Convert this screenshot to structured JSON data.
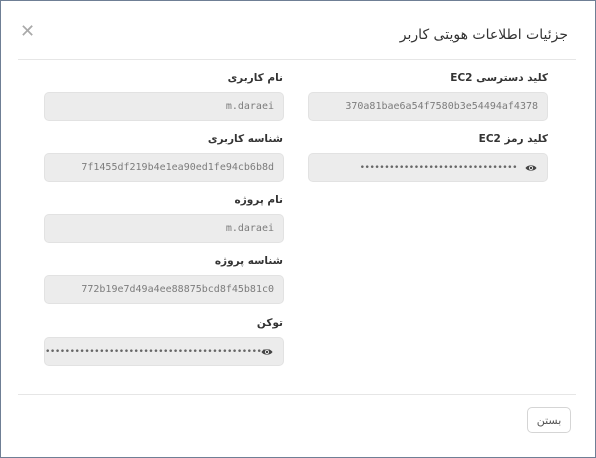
{
  "dialog": {
    "title": "جزئیات اطلاعات هویتی کاربر",
    "close_icon": "close-icon"
  },
  "right_column": {
    "ec2_access_key": {
      "label": "کلید دسترسی EC2",
      "value": "370a81bae6a54f7580b3e54494af4378"
    },
    "ec2_secret_key": {
      "label": "کلید رمز EC2",
      "value": "••••••••••••••••••••••••••••••••",
      "icon": "eye-icon"
    }
  },
  "left_column": {
    "username": {
      "label": "نام کاربری",
      "value": "m.daraei"
    },
    "user_id": {
      "label": "شناسه کاربری",
      "value": "7f1455df219b4e1ea90ed1fe94cb6b8d"
    },
    "project_name": {
      "label": "نام پروژه",
      "value": "m.daraei"
    },
    "project_id": {
      "label": "شناسه پروژه",
      "value": "772b19e7d49a4ee88875bcd8f45b81c0"
    },
    "token": {
      "label": "توکن",
      "value": "••••••••••••••••••••••••••••••••••••••••••••••",
      "icon": "eye-icon"
    }
  },
  "footer": {
    "close_button": "بستن"
  }
}
